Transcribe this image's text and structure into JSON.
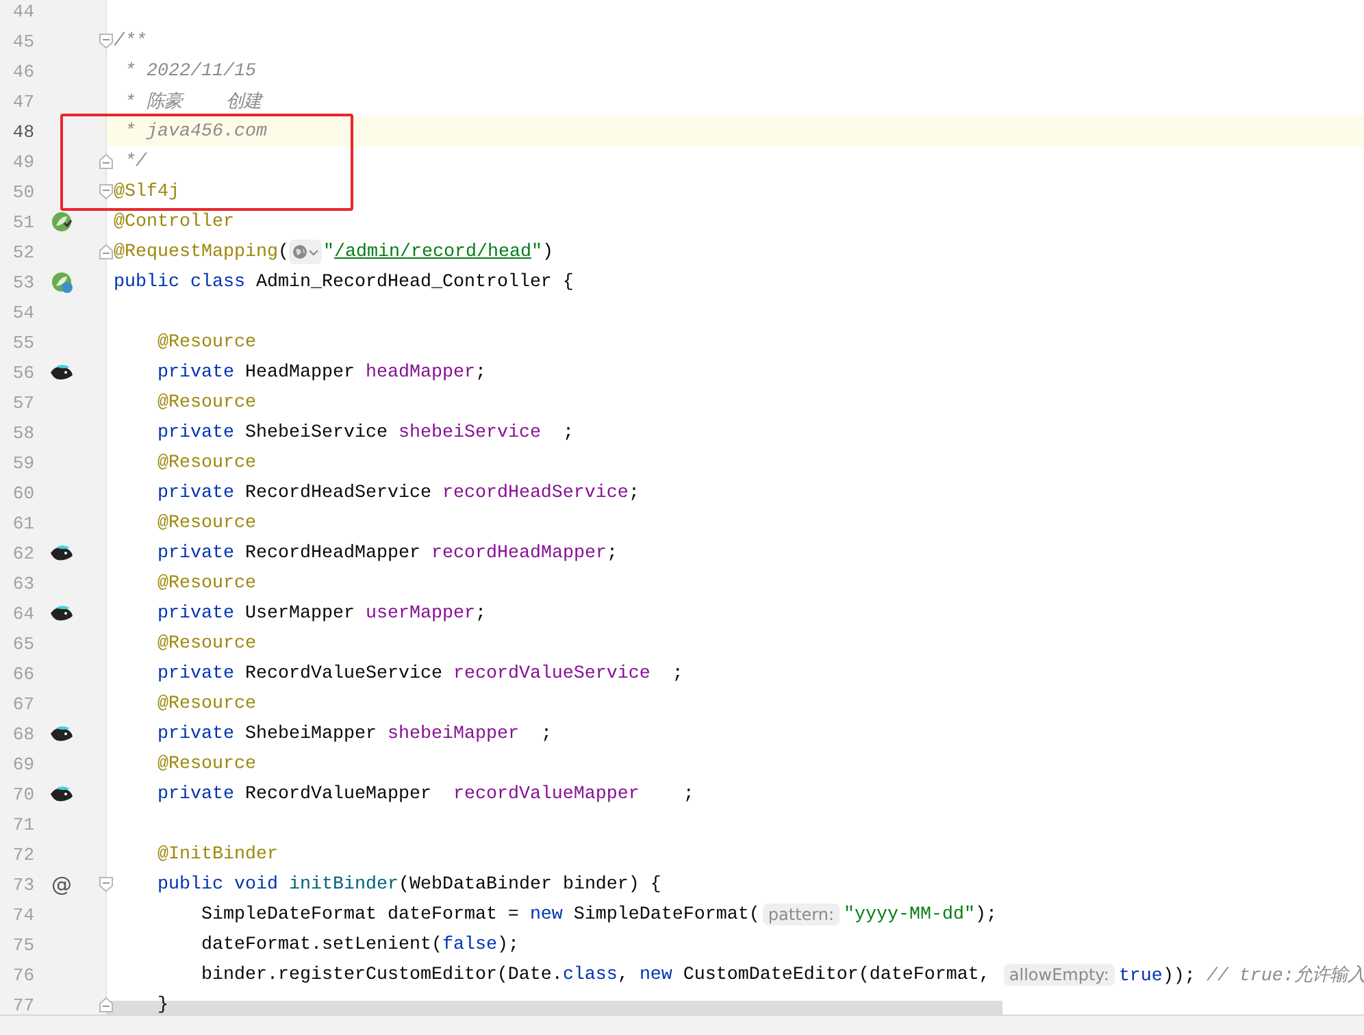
{
  "editor": {
    "overlay": {
      "kind": "highlight-box",
      "color": "#e8262b"
    },
    "lines": [
      {
        "number": "44",
        "current": false
      },
      {
        "number": "45",
        "current": false,
        "fold": {
          "kind": "start"
        },
        "tokens": [
          {
            "kind": "comment",
            "t": "/**"
          }
        ]
      },
      {
        "number": "46",
        "current": false,
        "tokens": [
          {
            "kind": "comment",
            "t": " * 2022/11/15"
          }
        ]
      },
      {
        "number": "47",
        "current": false,
        "tokens": [
          {
            "kind": "comment",
            "t": " * 陈豪    创建"
          }
        ]
      },
      {
        "number": "48",
        "current": true,
        "tokens": [
          {
            "kind": "comment",
            "t": " * java456.com"
          }
        ]
      },
      {
        "number": "49",
        "current": false,
        "fold": {
          "kind": "end"
        },
        "tokens": [
          {
            "kind": "comment",
            "t": " */"
          }
        ]
      },
      {
        "number": "50",
        "current": false,
        "fold": {
          "kind": "start"
        },
        "tokens": [
          {
            "kind": "annotation",
            "t": "@Slf4j"
          }
        ]
      },
      {
        "number": "51",
        "current": false,
        "gutter_icon": {
          "kind": "bean"
        },
        "tokens": [
          {
            "kind": "annotation",
            "t": "@Controller"
          }
        ]
      },
      {
        "number": "52",
        "current": false,
        "fold": {
          "kind": "end"
        },
        "tokens": [
          {
            "kind": "annotation",
            "t": "@RequestMapping"
          },
          {
            "kind": "plain",
            "t": "("
          },
          {
            "kind": "globe"
          },
          {
            "kind": "string",
            "t": "\""
          },
          {
            "kind": "url",
            "t": "/admin/record/head"
          },
          {
            "kind": "string",
            "t": "\""
          },
          {
            "kind": "plain",
            "t": ")"
          }
        ]
      },
      {
        "number": "53",
        "current": false,
        "gutter_icon": {
          "kind": "beanweb"
        },
        "tokens": [
          {
            "kind": "keyword",
            "t": "public class "
          },
          {
            "kind": "plain",
            "t": "Admin_RecordHead_Controller {"
          }
        ]
      },
      {
        "number": "54",
        "current": false
      },
      {
        "number": "55",
        "current": false,
        "tokens": [
          {
            "kind": "annotation",
            "t": "    @Resource"
          }
        ]
      },
      {
        "number": "56",
        "current": false,
        "gutter_icon": {
          "kind": "mapper"
        },
        "tokens": [
          {
            "kind": "keyword",
            "t": "    private "
          },
          {
            "kind": "plain",
            "t": "HeadMapper "
          },
          {
            "kind": "field",
            "t": "headMapper"
          },
          {
            "kind": "plain",
            "t": ";"
          }
        ]
      },
      {
        "number": "57",
        "current": false,
        "tokens": [
          {
            "kind": "annotation",
            "t": "    @Resource"
          }
        ]
      },
      {
        "number": "58",
        "current": false,
        "tokens": [
          {
            "kind": "keyword",
            "t": "    private "
          },
          {
            "kind": "plain",
            "t": "ShebeiService "
          },
          {
            "kind": "field",
            "t": "shebeiService"
          },
          {
            "kind": "plain",
            "t": "  ;"
          }
        ]
      },
      {
        "number": "59",
        "current": false,
        "tokens": [
          {
            "kind": "annotation",
            "t": "    @Resource"
          }
        ]
      },
      {
        "number": "60",
        "current": false,
        "tokens": [
          {
            "kind": "keyword",
            "t": "    private "
          },
          {
            "kind": "plain",
            "t": "RecordHeadService "
          },
          {
            "kind": "field",
            "t": "recordHeadService"
          },
          {
            "kind": "plain",
            "t": ";"
          }
        ]
      },
      {
        "number": "61",
        "current": false,
        "tokens": [
          {
            "kind": "annotation",
            "t": "    @Resource"
          }
        ]
      },
      {
        "number": "62",
        "current": false,
        "gutter_icon": {
          "kind": "mapper"
        },
        "tokens": [
          {
            "kind": "keyword",
            "t": "    private "
          },
          {
            "kind": "plain",
            "t": "RecordHeadMapper "
          },
          {
            "kind": "field",
            "t": "recordHeadMapper"
          },
          {
            "kind": "plain",
            "t": ";"
          }
        ]
      },
      {
        "number": "63",
        "current": false,
        "tokens": [
          {
            "kind": "annotation",
            "t": "    @Resource"
          }
        ]
      },
      {
        "number": "64",
        "current": false,
        "gutter_icon": {
          "kind": "mapper"
        },
        "tokens": [
          {
            "kind": "keyword",
            "t": "    private "
          },
          {
            "kind": "plain",
            "t": "UserMapper "
          },
          {
            "kind": "field",
            "t": "userMapper"
          },
          {
            "kind": "plain",
            "t": ";"
          }
        ]
      },
      {
        "number": "65",
        "current": false,
        "tokens": [
          {
            "kind": "annotation",
            "t": "    @Resource"
          }
        ]
      },
      {
        "number": "66",
        "current": false,
        "tokens": [
          {
            "kind": "keyword",
            "t": "    private "
          },
          {
            "kind": "plain",
            "t": "RecordValueService "
          },
          {
            "kind": "field",
            "t": "recordValueService"
          },
          {
            "kind": "plain",
            "t": "  ;"
          }
        ]
      },
      {
        "number": "67",
        "current": false,
        "tokens": [
          {
            "kind": "annotation",
            "t": "    @Resource"
          }
        ]
      },
      {
        "number": "68",
        "current": false,
        "gutter_icon": {
          "kind": "mapper"
        },
        "tokens": [
          {
            "kind": "keyword",
            "t": "    private "
          },
          {
            "kind": "plain",
            "t": "ShebeiMapper "
          },
          {
            "kind": "field",
            "t": "shebeiMapper"
          },
          {
            "kind": "plain",
            "t": "  ;"
          }
        ]
      },
      {
        "number": "69",
        "current": false,
        "tokens": [
          {
            "kind": "annotation",
            "t": "    @Resource"
          }
        ]
      },
      {
        "number": "70",
        "current": false,
        "gutter_icon": {
          "kind": "mapper"
        },
        "tokens": [
          {
            "kind": "keyword",
            "t": "    private "
          },
          {
            "kind": "plain",
            "t": "RecordValueMapper  "
          },
          {
            "kind": "field",
            "t": "recordValueMapper"
          },
          {
            "kind": "plain",
            "t": "    ;"
          }
        ]
      },
      {
        "number": "71",
        "current": false
      },
      {
        "number": "72",
        "current": false,
        "tokens": [
          {
            "kind": "annotation",
            "t": "    @InitBinder"
          }
        ]
      },
      {
        "number": "73",
        "current": false,
        "gutter_text": "@",
        "fold": {
          "kind": "start"
        },
        "tokens": [
          {
            "kind": "keyword",
            "t": "    public void "
          },
          {
            "kind": "method",
            "t": "initBinder"
          },
          {
            "kind": "plain",
            "t": "(WebDataBinder binder) {"
          }
        ]
      },
      {
        "number": "74",
        "current": false,
        "tokens": [
          {
            "kind": "plain",
            "t": "        SimpleDateFormat dateFormat = "
          },
          {
            "kind": "keyword",
            "t": "new"
          },
          {
            "kind": "plain",
            "t": " SimpleDateFormat("
          },
          {
            "kind": "hint",
            "t": "pattern:"
          },
          {
            "kind": "string",
            "t": "\"yyyy-MM-dd\""
          },
          {
            "kind": "plain",
            "t": ");"
          }
        ]
      },
      {
        "number": "75",
        "current": false,
        "tokens": [
          {
            "kind": "plain",
            "t": "        dateFormat.setLenient("
          },
          {
            "kind": "keyword",
            "t": "false"
          },
          {
            "kind": "plain",
            "t": ");"
          }
        ]
      },
      {
        "number": "76",
        "current": false,
        "tokens": [
          {
            "kind": "plain",
            "t": "        binder.registerCustomEditor(Date."
          },
          {
            "kind": "keyword",
            "t": "class"
          },
          {
            "kind": "plain",
            "t": ", "
          },
          {
            "kind": "keyword",
            "t": "new"
          },
          {
            "kind": "plain",
            "t": " CustomDateEditor(dateFormat, "
          },
          {
            "kind": "hint",
            "t": "allowEmpty:"
          },
          {
            "kind": "keyword",
            "t": "true"
          },
          {
            "kind": "plain",
            "t": ")); "
          },
          {
            "kind": "comment",
            "t": "// true:允许输入"
          }
        ]
      },
      {
        "number": "77",
        "current": false,
        "fold": {
          "kind": "end"
        },
        "tokens": [
          {
            "kind": "plain",
            "t": "    }"
          }
        ]
      }
    ]
  }
}
